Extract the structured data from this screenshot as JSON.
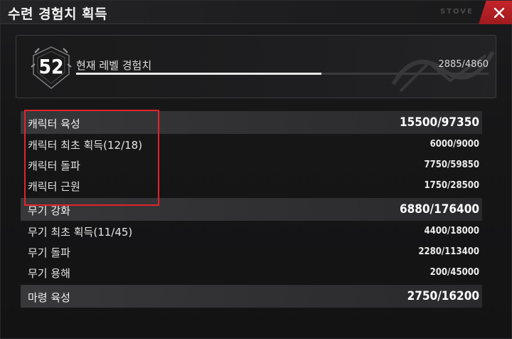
{
  "window": {
    "title": "수련 경험치 획득",
    "watermark": "STOVE"
  },
  "level": {
    "number": "52",
    "label": "현재 레벨 경험치",
    "exp_text": "2885/4860",
    "progress": 0.594
  },
  "groups": [
    {
      "label": "캐릭터 육성",
      "value": "15500/97350",
      "rows": [
        {
          "label": "캐릭터 최초 획득(12/18)",
          "value": "6000/9000"
        },
        {
          "label": "캐릭터 돌파",
          "value": "7750/59850"
        },
        {
          "label": "캐릭터 근원",
          "value": "1750/28500"
        }
      ]
    },
    {
      "label": "무기 강화",
      "value": "6880/176400",
      "rows": [
        {
          "label": "무기 최초 획득(11/45)",
          "value": "4400/18000"
        },
        {
          "label": "무기 돌파",
          "value": "2280/113400"
        },
        {
          "label": "무기 용해",
          "value": "200/45000"
        }
      ]
    },
    {
      "label": "마령 육성",
      "value": "2750/16200",
      "rows": []
    }
  ],
  "colors": {
    "accent_red": "#c4242a",
    "highlight": "#e0252b"
  },
  "icons": {
    "close": "close-icon",
    "level_badge": "level-badge-icon"
  }
}
